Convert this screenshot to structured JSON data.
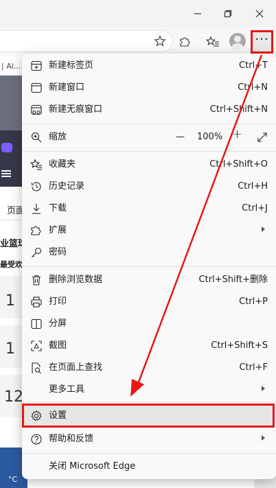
{
  "window": {
    "controls": [
      "minimize",
      "restore",
      "close"
    ]
  },
  "toolbar": {
    "more_label": "···"
  },
  "page": {
    "tab_fragment": "| Al...",
    "nav_fragment": "页面",
    "heading_fragment": "业篮球",
    "sub_fragment": "最受欢",
    "score_1": "1",
    "score_2": "1",
    "score_3": "12",
    "temp_fragment": "°C"
  },
  "menu": {
    "new_tab": {
      "label": "新建标签页",
      "shortcut": "Ctrl+T"
    },
    "new_window": {
      "label": "新建窗口",
      "shortcut": "Ctrl+N"
    },
    "new_inprivate": {
      "label": "新建无痕窗口",
      "shortcut": "Ctrl+Shift+N"
    },
    "zoom": {
      "label": "缩放",
      "minus": "—",
      "value": "100%",
      "plus": "+"
    },
    "favorites": {
      "label": "收藏夹",
      "shortcut": "Ctrl+Shift+O"
    },
    "history": {
      "label": "历史记录",
      "shortcut": "Ctrl+H"
    },
    "downloads": {
      "label": "下载",
      "shortcut": "Ctrl+J"
    },
    "extensions": {
      "label": "扩展"
    },
    "passwords": {
      "label": "密码"
    },
    "clear_data": {
      "label": "删除浏览数据",
      "shortcut": "Ctrl+Shift+删除"
    },
    "print": {
      "label": "打印",
      "shortcut": "Ctrl+P"
    },
    "split_screen": {
      "label": "分屏"
    },
    "screenshot": {
      "label": "截图",
      "shortcut": "Ctrl+Shift+S"
    },
    "find": {
      "label": "在页面上查找",
      "shortcut": "Ctrl+F"
    },
    "more_tools": {
      "label": "更多工具"
    },
    "settings": {
      "label": "设置"
    },
    "help": {
      "label": "帮助和反馈"
    },
    "close_edge": {
      "label": "关闭 Microsoft Edge"
    }
  },
  "annotation": {
    "highlight_color": "#e81616"
  }
}
